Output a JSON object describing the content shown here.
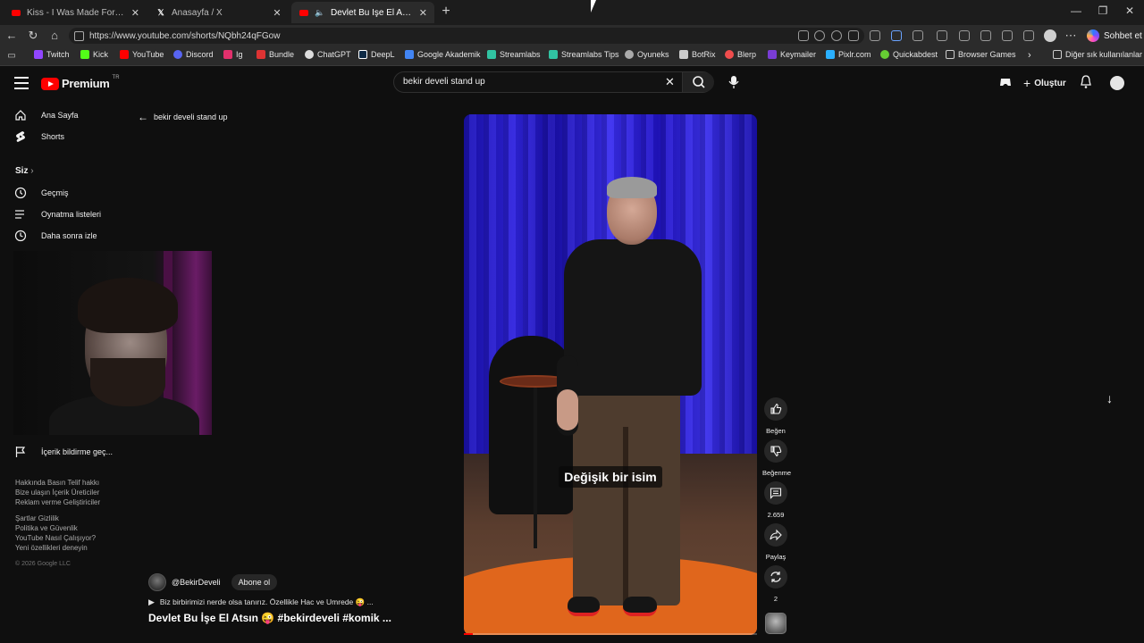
{
  "browser": {
    "tabs": [
      {
        "title": "Kiss - I Was Made For Lovin' You -",
        "favicon": "youtube-icon",
        "active": false
      },
      {
        "title": "Anasayfa / X",
        "favicon": "x-icon",
        "active": false
      },
      {
        "title": "Devlet Bu İşe El Atsın 😜 #be",
        "favicon": "youtube-icon",
        "active": true
      }
    ],
    "url": "https://www.youtube.com/shorts/NQbh24qFGow",
    "copilot_label": "Sohbet et",
    "bookmarks": [
      "Twitch",
      "Kick",
      "YouTube",
      "Discord",
      "Ig",
      "Bundle",
      "ChatGPT",
      "DeepL",
      "Google Akademik",
      "Streamlabs",
      "Streamlabs Tips",
      "Oyuneks",
      "BotRix",
      "Blerp",
      "Keymailer",
      "Pixlr.com",
      "Quickabdest",
      "Browser Games"
    ],
    "other_bookmarks": "Diğer sık kullanılanlar"
  },
  "youtube": {
    "logo_word": "Premium",
    "logo_country": "TR",
    "search_query": "bekir develi stand up",
    "create_label": "Oluştur"
  },
  "sidebar": {
    "home": "Ana Sayfa",
    "shorts": "Shorts",
    "you_header": "Siz",
    "history": "Geçmiş",
    "playlists": "Oynatma listeleri",
    "watch_later": "Daha sonra izle",
    "report_history": "İçerik bildirme geç...",
    "footer": [
      "Hakkında  Basın  Telif hakkı",
      "Bize ulaşın  İçerik Üreticiler",
      "Reklam verme  Geliştiriciler",
      "",
      "Şartlar  Gizlilik",
      "Politika ve Güvenlik",
      "YouTube Nasıl Çalışıyor?",
      "Yeni özellikleri deneyin"
    ],
    "copyright": "© 2026 Google LLC"
  },
  "shorts": {
    "back_label": "bekir develi stand up",
    "caption": "Değişik bir isim",
    "progress": 0.03,
    "channel": "@BekirDeveli",
    "subscribe": "Abone ol",
    "description": "Biz birbirimizi nerde olsa tanırız. Özellikle Hac ve Umrede 😜 ...",
    "title": "Devlet Bu İşe El Atsın 😜 #bekirdeveli #komik ...",
    "actions": {
      "like": "Beğen",
      "dislike": "Beğenme",
      "comments": "2.659",
      "share": "Paylaş",
      "remix": "2"
    }
  }
}
